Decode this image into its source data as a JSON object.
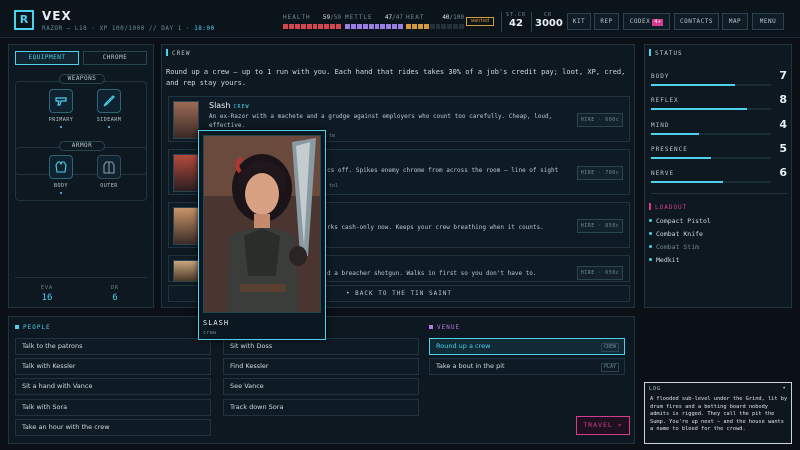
{
  "header": {
    "logo": "R",
    "name": "VEX",
    "subtitle": "RAZOR — L18 · XP 100/1000 // DAY 1 · ",
    "time": "18:00",
    "stats": [
      {
        "name": "HEALTH",
        "value": "59",
        "max": "/59",
        "level": 1.0,
        "color": "#d4474f"
      },
      {
        "name": "METTLE",
        "value": "47",
        "max": "/47",
        "level": 1.0,
        "color": "#9a7ee0"
      },
      {
        "name": "HEAT",
        "value": "40",
        "max": "/100",
        "level": 0.4,
        "color": "#d49b3a"
      }
    ],
    "wanted": "wanted",
    "street_cred": {
      "label": "ST.CR",
      "value": "42"
    },
    "credits": {
      "label": "CR",
      "value": "3000"
    },
    "buttons": {
      "kit": "KIT",
      "rep": "REP",
      "codex": "CODEX",
      "codex_badge": "4+",
      "contacts": "CONTACTS",
      "map": "MAP",
      "menu": "MENU"
    }
  },
  "left": {
    "tabs": {
      "equipment": "EQUIPMENT",
      "chrome": "CHROME"
    },
    "weapons_title": "WEAPONS",
    "primary_label": "PRIMARY",
    "sidearm_label": "SIDEARM",
    "armor_title": "ARMOR",
    "body_label": "BODY",
    "outer_label": "OUTER",
    "eva": {
      "label": "EVA",
      "value": "16"
    },
    "dr": {
      "label": "DR",
      "value": "6"
    }
  },
  "crew": {
    "title": "CREW",
    "intro": "Round up a crew — up to 1 run with you. Each hand that rides takes 30% of a job's credit pay; loot, XP, cred, and rep stay yours.",
    "members": [
      {
        "name": "Slash",
        "role": "CREW",
        "desc": "An ex-Razor with a machete and a grudge against employers who count too carefully. Cheap, loud, effective.",
        "extra": "te",
        "hire": "HIRE · 600c"
      },
      {
        "name": "",
        "role": "",
        "desc": "cs off. Spikes enemy chrome from across the room — line of sight",
        "extra": "tol",
        "hire": "HIRE · 700c"
      },
      {
        "name": "",
        "role": "",
        "desc": "rks cash-only now. Keeps your crew breathing when it counts.",
        "extra": "",
        "hire": "HIRE · 850c"
      },
      {
        "name": "",
        "role": "",
        "desc": "d a breacher shotgun. Walks in first so you don't have to.",
        "extra": "",
        "hire": "HIRE · 650c"
      }
    ],
    "back": "• BACK TO THE TIN SAINT"
  },
  "popup": {
    "name": "SLASH",
    "role": "crew"
  },
  "status": {
    "title": "STATUS",
    "stats": [
      {
        "name": "BODY",
        "value": "7",
        "level": 0.7
      },
      {
        "name": "REFLEX",
        "value": "8",
        "level": 0.8
      },
      {
        "name": "MIND",
        "value": "4",
        "level": 0.4
      },
      {
        "name": "PRESENCE",
        "value": "5",
        "level": 0.5
      },
      {
        "name": "NERVE",
        "value": "6",
        "level": 0.6
      }
    ],
    "loadout_title": "LOADOUT",
    "loadout": [
      "Compact Pistol",
      "Combat Knife",
      "Combat Stim",
      "Medkit"
    ]
  },
  "people": {
    "title": "PEOPLE",
    "col1": [
      "Talk to the patrons",
      "Talk with Kessler",
      "Sit a hand with Vance",
      "Talk with Sora",
      "Take an hour with the crew"
    ],
    "col2": [
      "Sit with Doss",
      "Find Kessler",
      "See Vance",
      "Track down Sora"
    ]
  },
  "venue": {
    "title": "VENUE",
    "actions": [
      {
        "label": "Round up a crew",
        "tag": "CREW"
      },
      {
        "label": "Take a bout in the pit",
        "tag": "PLAY"
      }
    ]
  },
  "travel": "TRAVEL »",
  "log": {
    "title": "LOG",
    "toggle": "•",
    "text": "A flooded sub-level under the Grind, lit by drum fires and a betting board nobody admits is rigged. They call the pit the Sump. You're up next — and the house wants a name to bleed for the crowd."
  }
}
